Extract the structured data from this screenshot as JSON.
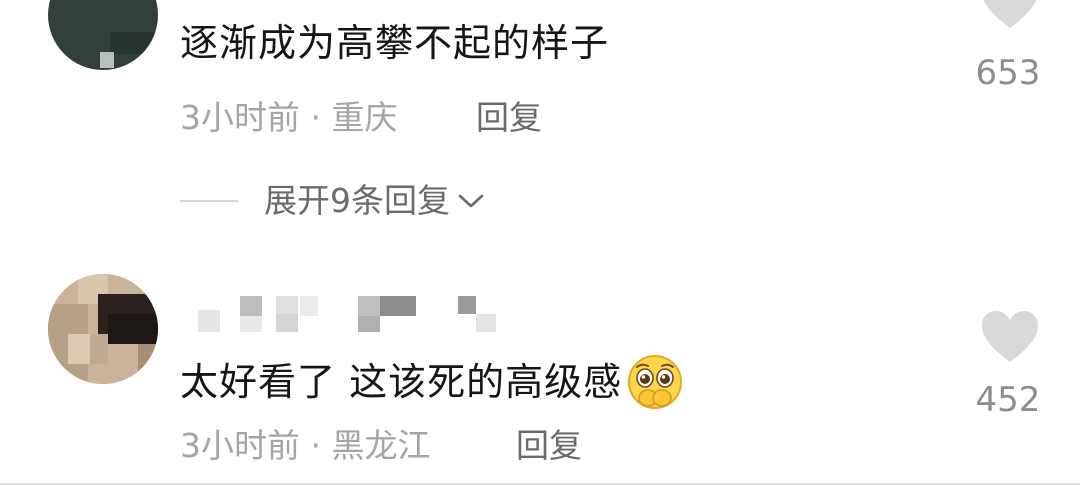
{
  "comments": [
    {
      "text": "逐渐成为高攀不起的样子",
      "time_location": "3小时前 · 重庆",
      "reply_label": "回复",
      "likes": "653",
      "expand_label": "展开9条回复"
    },
    {
      "text": "太好看了 这该死的高级感",
      "time_location": "3小时前 · 黑龙江",
      "reply_label": "回复",
      "likes": "452"
    }
  ],
  "icons": {
    "like": "heart-icon",
    "expand": "chevron-down-icon",
    "emoji": "pleading-face-emoji"
  },
  "colors": {
    "text": "#161616",
    "meta": "#a5a5a5",
    "action": "#6b6b6b",
    "like_icon": "#d9d9d9"
  }
}
